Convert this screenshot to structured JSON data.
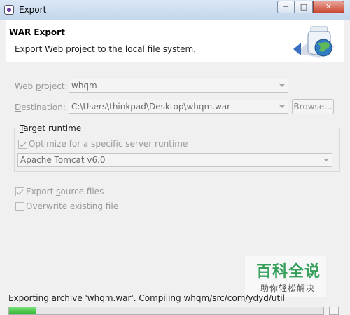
{
  "window": {
    "title": "Export",
    "controls": {
      "minimize": "─",
      "maximize": "□",
      "close": "✕"
    }
  },
  "header": {
    "title": "WAR Export",
    "description": "Export Web project to the local file system.",
    "art_icon": "jar-with-globe-icon"
  },
  "form": {
    "web_project": {
      "label_pre": "Web ",
      "label_key": "p",
      "label_post": "roject:",
      "value": "whqm"
    },
    "destination": {
      "label_key": "D",
      "label_post": "estination:",
      "value": "C:\\Users\\thinkpad\\Desktop\\whqm.war",
      "browse_label": "Browse..."
    }
  },
  "target_runtime": {
    "group_key": "T",
    "group_post": "arget runtime",
    "optimize": {
      "label": "Optimize for a specific server runtime",
      "checked": true
    },
    "runtime_value": "Apache Tomcat v6.0"
  },
  "options": {
    "export_source": {
      "label_pre": "Export ",
      "label_key": "s",
      "label_post": "ource files",
      "checked": true
    },
    "overwrite": {
      "label_pre": "Over",
      "label_key": "w",
      "label_post": "rite existing file",
      "checked": false
    }
  },
  "status": {
    "text": "Exporting archive 'whqm.war'. Compiling whqm/src/com/ydyd/util",
    "progress": 0.085
  },
  "watermark": {
    "big": "百科全说",
    "small": "助你轻松解决"
  },
  "colors": {
    "progress_green": "#2fb52f",
    "watermark_green": "#34a05a",
    "close_red": "#c9462f"
  }
}
